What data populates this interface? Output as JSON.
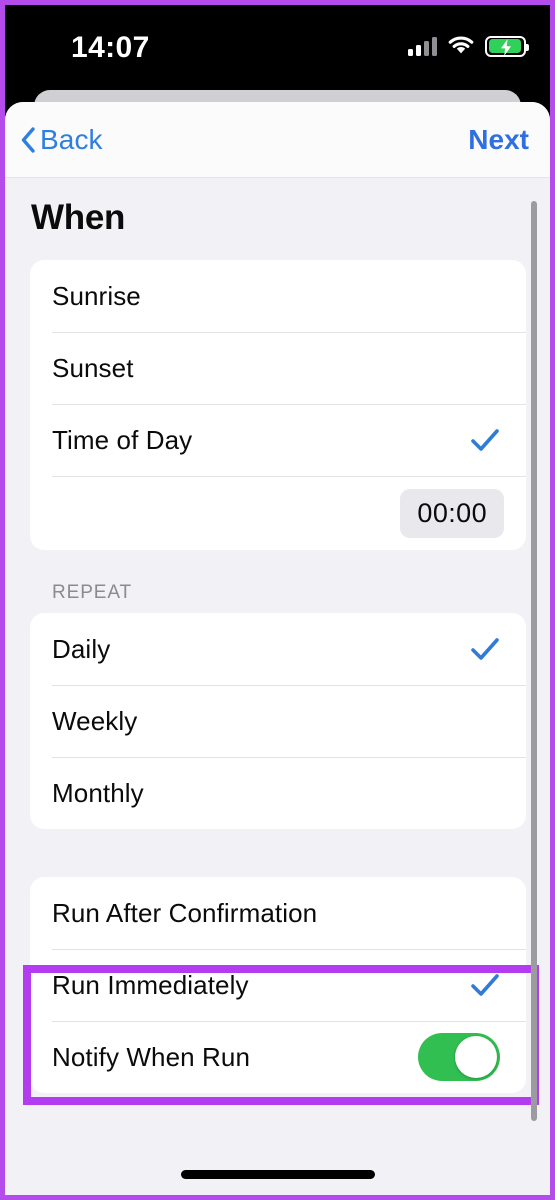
{
  "status_bar": {
    "time": "14:07",
    "cellular_icon": "cellular-signal-icon",
    "cellular_bars_filled": 2,
    "cellular_bars_total": 4,
    "wifi_icon": "wifi-icon",
    "battery_icon": "battery-charging-icon",
    "battery_charging": true,
    "battery_color": "#30d158"
  },
  "navbar": {
    "back_label": "Back",
    "next_label": "Next",
    "back_icon": "chevron-left-icon",
    "accent_color": "#2f7fe0"
  },
  "page": {
    "title": "When",
    "background_color": "#f2f1f6"
  },
  "trigger_section": {
    "rows": [
      {
        "label": "Sunrise",
        "selected": false
      },
      {
        "label": "Sunset",
        "selected": false
      },
      {
        "label": "Time of Day",
        "selected": true
      }
    ],
    "time_value": "00:00"
  },
  "repeat_section": {
    "header": "REPEAT",
    "rows": [
      {
        "label": "Daily",
        "selected": true
      },
      {
        "label": "Weekly",
        "selected": false
      },
      {
        "label": "Monthly",
        "selected": false
      }
    ]
  },
  "run_section": {
    "rows": [
      {
        "label": "Run After Confirmation",
        "selected": false
      },
      {
        "label": "Run Immediately",
        "selected": true
      },
      {
        "label": "Notify When Run",
        "toggle_on": true
      }
    ]
  },
  "annotation": {
    "highlight_color": "#b43cf0",
    "frame_color": "#b34ceb"
  },
  "checkmark_color": "#2f7cd8",
  "toggle_on_color": "#32bf52"
}
